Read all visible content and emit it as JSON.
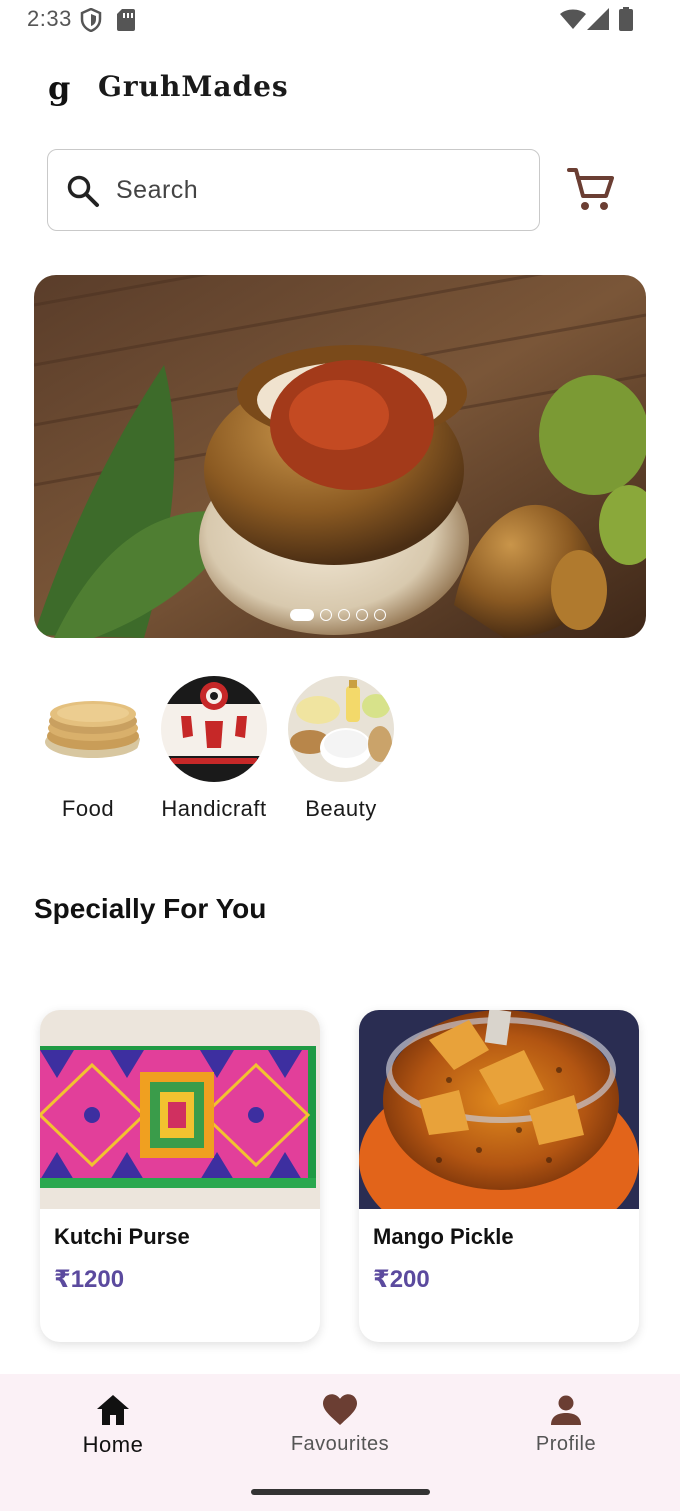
{
  "status_bar": {
    "time": "2:33",
    "icons": [
      "shield-icon",
      "sim-card-icon",
      "wifi-icon",
      "signal-icon",
      "battery-icon"
    ]
  },
  "header": {
    "logo_letter": "g",
    "title": "GruhMades"
  },
  "search": {
    "placeholder": "Search",
    "value": ""
  },
  "banner": {
    "slide_count": 5,
    "active_slide": 1,
    "image": "pickle-jar-photo"
  },
  "categories": [
    {
      "label": "Food",
      "image": "flatbread-stack-photo"
    },
    {
      "label": "Handicraft",
      "image": "embroidered-plate-photo"
    },
    {
      "label": "Beauty",
      "image": "beauty-products-photo"
    }
  ],
  "section": {
    "title": "Specially For You"
  },
  "products": [
    {
      "name": "Kutchi Purse",
      "price": "₹1200",
      "image": "kutchi-purse-photo"
    },
    {
      "name": "Mango Pickle",
      "price": "₹200",
      "image": "mango-pickle-photo"
    }
  ],
  "bottom_nav": [
    {
      "label": "Home",
      "icon": "home-icon",
      "active": true
    },
    {
      "label": "Favourites",
      "icon": "heart-icon",
      "active": false
    },
    {
      "label": "Profile",
      "icon": "person-icon",
      "active": false
    }
  ],
  "colors": {
    "accent": "#5b4a9e",
    "brown": "#6b3e33",
    "nav_bg": "#fbf1f6"
  }
}
